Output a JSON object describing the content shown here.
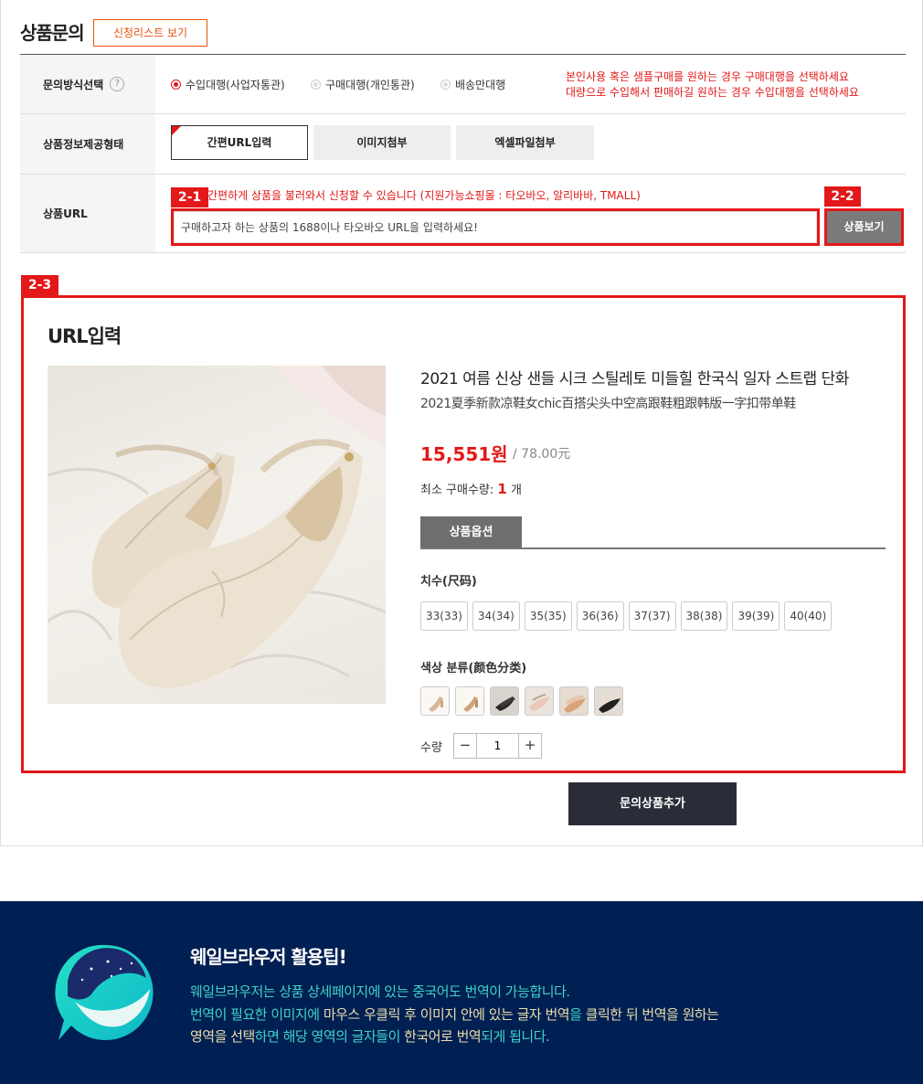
{
  "header": {
    "title": "상품문의",
    "list_button": "신청리스트 보기"
  },
  "method_row": {
    "label": "문의방식선택",
    "help_icon": "?",
    "options": [
      {
        "label": "수입대행(사업자통관)",
        "selected": true
      },
      {
        "label": "구매대행(개인통관)",
        "selected": false
      },
      {
        "label": "배송만대행",
        "selected": false
      }
    ],
    "notice_line1": "본인사용 혹은 샘플구매를 원하는 경우 구매대행을 선택하세요",
    "notice_line2": "대량으로 수입해서 판매하길 원하는 경우 수입대행을 선택하세요"
  },
  "form_row": {
    "label": "상품정보제공형태",
    "tabs": [
      {
        "label": "간편URL입력",
        "active": true
      },
      {
        "label": "이미지첨부",
        "active": false
      },
      {
        "label": "엑셀파일첨부",
        "active": false
      }
    ]
  },
  "url_row": {
    "label": "상품URL",
    "badge_input": "2-1",
    "badge_button": "2-2",
    "hint": "간편하게 상품을 불러와서 신청할 수 있습니다 (지원가능쇼핑몰 : 타오바오, 알리바바, TMALL)",
    "placeholder": "구매하고자 하는 상품의 1688이나 타오바오 URL을 입력하세요!",
    "view_button": "상품보기"
  },
  "result": {
    "badge": "2-3",
    "title": "URL입력",
    "product": {
      "title_ko": "2021 여름 신상 샌들 시크 스틸레토 미들힐 한국식 일자 스트랩 단화",
      "title_cn": "2021夏季新款凉鞋女chic百搭尖头中空高跟鞋粗跟韩版一字扣带单鞋",
      "price_krw": "15,551원",
      "price_cny": "/ 78.00元",
      "min_qty_label": "최소 구매수량:",
      "min_qty_value": "1",
      "min_qty_unit": "개",
      "options_tab": "상품옵션",
      "size_label": "치수(尺码)",
      "sizes": [
        "33(33)",
        "34(34)",
        "35(35)",
        "36(36)",
        "37(37)",
        "38(38)",
        "39(39)",
        "40(40)"
      ],
      "color_label": "색상 분류(颜色分类)",
      "color_swatch_count": 6,
      "qty_label": "수량",
      "qty_minus": "−",
      "qty_value": "1",
      "qty_plus": "+"
    }
  },
  "add_button": "문의상품추가",
  "tip": {
    "title": "웨일브라우저 활용팁!",
    "line1": "웨일브라우저는 상품 상세페이지에 있는 중국어도 번역이 가능합니다.",
    "line2_a": "번역이 필요한 이미지에 ",
    "line2_b": "마우스 우클릭 후 이미지 안에 있는 글자 번역",
    "line2_c": "을 ",
    "line2_d": "클릭한 뒤",
    "line2_e": " 번역을 원하는",
    "line3_a": "영역을 선택",
    "line3_b": "하면 해당 영역의 글자들이 ",
    "line3_c": "한국어로 번역",
    "line3_d": "되게 됩니다."
  },
  "colors": {
    "accent_red": "#e31818",
    "accent_orange": "#e8520f",
    "tip_bg": "#001f52",
    "tip_teal": "#3fd3c8",
    "tip_cream": "#eadfab"
  }
}
